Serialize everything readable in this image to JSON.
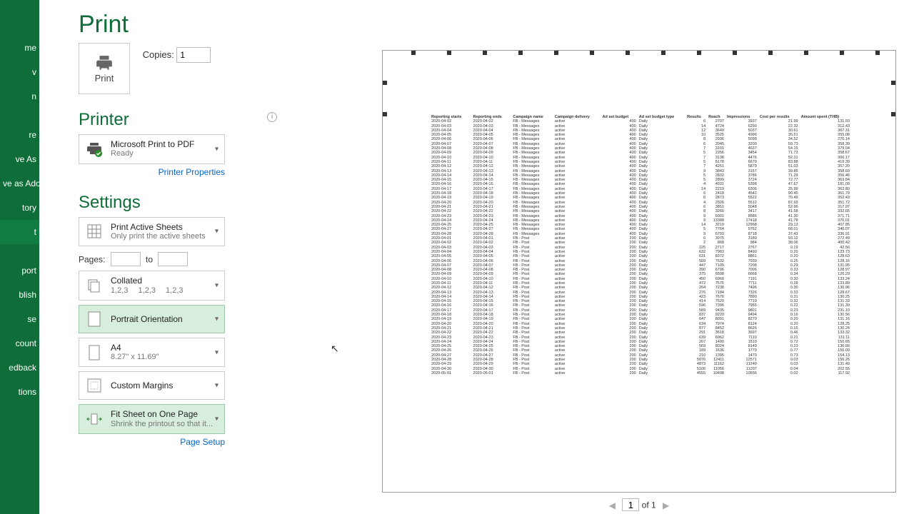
{
  "nav": [
    "me",
    "v",
    "n",
    "",
    "re",
    "ve As",
    "ve as Adobe\nF",
    "tory",
    "t",
    "",
    "port",
    "blish",
    "se",
    "count",
    "edback",
    "tions"
  ],
  "title": "Print",
  "print_label": "Print",
  "copies_label": "Copies:",
  "copies_value": "1",
  "printer_heading": "Printer",
  "printer": {
    "name": "Microsoft Print to PDF",
    "status": "Ready"
  },
  "printer_props": "Printer Properties",
  "settings_heading": "Settings",
  "what": {
    "t1": "Print Active Sheets",
    "t2": "Only print the active sheets"
  },
  "pages_label": "Pages:",
  "pages_to": "to",
  "collate": {
    "t1": "Collated",
    "t2": "1,2,3  1,2,3  1,2,3"
  },
  "orient": "Portrait Orientation",
  "paper": {
    "t1": "A4",
    "t2": "8.27\" x 11.69\""
  },
  "margins": "Custom Margins",
  "fit": {
    "t1": "Fit Sheet on One Page",
    "t2": "Shrink the printout so that it..."
  },
  "page_setup": "Page Setup",
  "page_of": "of 1",
  "page_current": "1",
  "headers": [
    "Reporting starts",
    "Reporting ends",
    "Campaign name",
    "Campaign delivery",
    "Ad set budget",
    "Ad set budget type",
    "Results",
    "Reach",
    "Impressions",
    "Cost per results",
    "Amount spent (THB)"
  ],
  "rows": [
    [
      "2020-04-02",
      "2020-04-02",
      "FB - Messages",
      "active",
      "400",
      "Daily",
      "6",
      "2707",
      "3937",
      "21.99",
      "131.93"
    ],
    [
      "2020-04-03",
      "2020-04-03",
      "FB - Messages",
      "active",
      "400",
      "Daily",
      "14",
      "4724",
      "6290",
      "22.32",
      "312.43"
    ],
    [
      "2020-04-04",
      "2020-04-04",
      "FB - Messages",
      "active",
      "400",
      "Daily",
      "12",
      "3649",
      "5037",
      "30.61",
      "367.31"
    ],
    [
      "2020-04-05",
      "2020-04-05",
      "FB - Messages",
      "active",
      "400",
      "Daily",
      "10",
      "3525",
      "4996",
      "35.51",
      "355.08"
    ],
    [
      "2020-04-06",
      "2020-04-06",
      "FB - Messages",
      "active",
      "400",
      "Daily",
      "8",
      "2936",
      "5098",
      "34.52",
      "276.14"
    ],
    [
      "2020-04-07",
      "2020-04-07",
      "FB - Messages",
      "active",
      "400",
      "Daily",
      "6",
      "2045",
      "3200",
      "59.73",
      "358.39"
    ],
    [
      "2020-04-08",
      "2020-04-08",
      "FB - Messages",
      "active",
      "400",
      "Daily",
      "7",
      "3101",
      "4637",
      "54.15",
      "379.04"
    ],
    [
      "2020-04-09",
      "2020-04-09",
      "FB - Messages",
      "active",
      "400",
      "Daily",
      "5",
      "2356",
      "3454",
      "71.73",
      "358.67"
    ],
    [
      "2020-04-10",
      "2020-04-10",
      "FB - Messages",
      "active",
      "400",
      "Daily",
      "7",
      "3138",
      "4476",
      "52.31",
      "366.17"
    ],
    [
      "2020-04-11",
      "2020-04-11",
      "FB - Messages",
      "active",
      "400",
      "Daily",
      "5",
      "5178",
      "6679",
      "83.88",
      "419.39"
    ],
    [
      "2020-04-12",
      "2020-04-12",
      "FB - Messages",
      "active",
      "400",
      "Daily",
      "7",
      "4251",
      "5879",
      "51.03",
      "357.20"
    ],
    [
      "2020-04-13",
      "2020-04-13",
      "FB - Messages",
      "active",
      "400",
      "Daily",
      "9",
      "3843",
      "3157",
      "39.85",
      "358.69"
    ],
    [
      "2020-04-14",
      "2020-04-14",
      "FB - Messages",
      "active",
      "400",
      "Daily",
      "5",
      "2832",
      "3786",
      "71.29",
      "356.46"
    ],
    [
      "2020-04-15",
      "2020-04-15",
      "FB - Messages",
      "active",
      "400",
      "Daily",
      "5",
      "2899",
      "3724",
      "72.77",
      "363.84"
    ],
    [
      "2020-04-16",
      "2020-04-16",
      "FB - Messages",
      "active",
      "400",
      "Daily",
      "4",
      "4031",
      "5398",
      "47.67",
      "181.09"
    ],
    [
      "2020-04-17",
      "2020-04-17",
      "FB - Messages",
      "active",
      "400",
      "Daily",
      "14",
      "2219",
      "6306",
      "25.99",
      "363.80"
    ],
    [
      "2020-04-18",
      "2020-04-18",
      "FB - Messages",
      "active",
      "400",
      "Daily",
      "6",
      "2418",
      "4542",
      "90.45",
      "361.79"
    ],
    [
      "2020-04-19",
      "2020-04-19",
      "FB - Messages",
      "active",
      "400",
      "Daily",
      "6",
      "2873",
      "5522",
      "70.49",
      "352.43"
    ],
    [
      "2020-04-20",
      "2020-04-20",
      "FB - Messages",
      "active",
      "400",
      "Daily",
      "4",
      "2926",
      "5512",
      "87.93",
      "351.72"
    ],
    [
      "2020-04-21",
      "2020-04-21",
      "FB - Messages",
      "active",
      "400",
      "Daily",
      "6",
      "3851",
      "5048",
      "52.96",
      "317.97"
    ],
    [
      "2020-04-22",
      "2020-04-22",
      "FB - Messages",
      "active",
      "400",
      "Daily",
      "8",
      "3266",
      "3417",
      "41.58",
      "332.65"
    ],
    [
      "2020-04-23",
      "2020-04-23",
      "FB - Messages",
      "active",
      "400",
      "Daily",
      "9",
      "6001",
      "8586",
      "41.30",
      "371.71"
    ],
    [
      "2020-04-24",
      "2020-04-24",
      "FB - Messages",
      "active",
      "400",
      "Daily",
      "9",
      "13388",
      "17418",
      "41.78",
      "376.01"
    ],
    [
      "2020-04-25",
      "2020-04-25",
      "FB - Messages",
      "active",
      "400",
      "Daily",
      "14",
      "3219",
      "12968",
      "29.13",
      "407.85"
    ],
    [
      "2020-04-27",
      "2020-04-27",
      "FB - Messages",
      "active",
      "400",
      "Daily",
      "5",
      "7764",
      "9762",
      "68.01",
      "340.07"
    ],
    [
      "2020-04-28",
      "2020-04-28",
      "FB - Messages",
      "active",
      "400",
      "Daily",
      "9",
      "6793",
      "8718",
      "37.43",
      "336.91"
    ],
    [
      "2020-04-01",
      "2020-04-01",
      "FB - Post",
      "active",
      "200",
      "Daily",
      "6",
      "3075",
      "3180",
      "93.12",
      "272.49"
    ],
    [
      "2020-04-02",
      "2020-04-02",
      "FB - Post",
      "active",
      "200",
      "Daily",
      "2",
      "868",
      "984",
      "38.06",
      "400.42"
    ],
    [
      "2020-04-03",
      "2020-04-03",
      "FB - Post",
      "active",
      "200",
      "Daily",
      "225",
      "2717",
      "2767",
      "0.19",
      "42.56"
    ],
    [
      "2020-04-04",
      "2020-04-04",
      "FB - Post",
      "active",
      "200",
      "Daily",
      "632",
      "7983",
      "8490",
      "0.20",
      "123.73"
    ],
    [
      "2020-04-05",
      "2020-04-05",
      "FB - Post",
      "active",
      "200",
      "Daily",
      "631",
      "8372",
      "8861",
      "0.20",
      "128.63"
    ],
    [
      "2020-04-06",
      "2020-04-06",
      "FB - Post",
      "active",
      "200",
      "Daily",
      "509",
      "7632",
      "7939",
      "0.25",
      "128.16"
    ],
    [
      "2020-04-07",
      "2020-04-07",
      "FB - Post",
      "active",
      "200",
      "Daily",
      "447",
      "7105",
      "7208",
      "0.29",
      "131.95"
    ],
    [
      "2020-04-08",
      "2020-04-08",
      "FB - Post",
      "active",
      "200",
      "Daily",
      "390",
      "6796",
      "7006",
      "0.33",
      "128.97"
    ],
    [
      "2020-04-09",
      "2020-04-09",
      "FB - Post",
      "active",
      "200",
      "Daily",
      "375",
      "6508",
      "6668",
      "0.34",
      "126.29"
    ],
    [
      "2020-04-10",
      "2020-04-10",
      "FB - Post",
      "active",
      "200",
      "Daily",
      "450",
      "6966",
      "7191",
      "0.30",
      "133.24"
    ],
    [
      "2020-04-11",
      "2020-04-11",
      "FB - Post",
      "active",
      "200",
      "Daily",
      "472",
      "7575",
      "7711",
      "0.28",
      "133.89"
    ],
    [
      "2020-04-12",
      "2020-04-12",
      "FB - Post",
      "active",
      "200",
      "Daily",
      "264",
      "7238",
      "7496",
      "0.30",
      "130.96"
    ],
    [
      "2020-04-13",
      "2020-04-13",
      "FB - Post",
      "active",
      "200",
      "Daily",
      "276",
      "7184",
      "7326",
      "0.33",
      "128.67"
    ],
    [
      "2020-04-14",
      "2020-04-14",
      "FB - Post",
      "active",
      "200",
      "Daily",
      "423",
      "7676",
      "7890",
      "0.31",
      "130.25"
    ],
    [
      "2020-04-15",
      "2020-04-15",
      "FB - Post",
      "active",
      "200",
      "Daily",
      "414",
      "7520",
      "7719",
      "0.32",
      "131.33"
    ],
    [
      "2020-04-16",
      "2020-04-16",
      "FB - Post",
      "active",
      "200",
      "Daily",
      "596",
      "7396",
      "7955",
      "0.22",
      "131.39"
    ],
    [
      "2020-04-17",
      "2020-04-17",
      "FB - Post",
      "active",
      "200",
      "Daily",
      "589",
      "9435",
      "9801",
      "0.23",
      "231.10"
    ],
    [
      "2020-04-18",
      "2020-04-18",
      "FB - Post",
      "active",
      "200",
      "Daily",
      "837",
      "9220",
      "9494",
      "0.16",
      "130.56"
    ],
    [
      "2020-04-19",
      "2020-04-19",
      "FB - Post",
      "active",
      "200",
      "Daily",
      "647",
      "8091",
      "8270",
      "0.20",
      "131.16"
    ],
    [
      "2020-04-20",
      "2020-04-20",
      "FB - Post",
      "active",
      "200",
      "Daily",
      "634",
      "7974",
      "8124",
      "0.20",
      "128.25"
    ],
    [
      "2020-04-21",
      "2020-04-21",
      "FB - Post",
      "active",
      "200",
      "Daily",
      "877",
      "8452",
      "8626",
      "0.15",
      "130.24"
    ],
    [
      "2020-04-22",
      "2020-04-22",
      "FB - Post",
      "active",
      "200",
      "Daily",
      "291",
      "3618",
      "3697",
      "0.46",
      "133.32"
    ],
    [
      "2020-04-23",
      "2020-04-23",
      "FB - Post",
      "active",
      "200",
      "Daily",
      "639",
      "6962",
      "7110",
      "0.21",
      "131.11"
    ],
    [
      "2020-04-24",
      "2020-04-24",
      "FB - Post",
      "active",
      "200",
      "Daily",
      "207",
      "1490",
      "1519",
      "0.72",
      "150.65"
    ],
    [
      "2020-04-25",
      "2020-04-25",
      "FB - Post",
      "active",
      "200",
      "Daily",
      "569",
      "8024",
      "8149",
      "0.23",
      "130.66"
    ],
    [
      "2020-04-26",
      "2020-04-26",
      "FB - Post",
      "active",
      "200",
      "Daily",
      "189",
      "1636",
      "1779",
      "0.77",
      "150.09"
    ],
    [
      "2020-04-27",
      "2020-04-27",
      "FB - Post",
      "active",
      "200",
      "Daily",
      "210",
      "1395",
      "1470",
      "0.73",
      "154.13"
    ],
    [
      "2020-04-28",
      "2020-04-28",
      "FB - Post",
      "active",
      "200",
      "Daily",
      "5076",
      "12411",
      "12571",
      "0.03",
      "150.26"
    ],
    [
      "2020-04-29",
      "2020-04-29",
      "FB - Post",
      "active",
      "200",
      "Daily",
      "4873",
      "11162",
      "11249",
      "0.03",
      "131.49"
    ],
    [
      "2020-04-30",
      "2020-04-30",
      "FB - Post",
      "active",
      "200",
      "Daily",
      "5106",
      "11056",
      "11207",
      "0.04",
      "202.55"
    ],
    [
      "2020-05-01",
      "2020-05-01",
      "FB - Post",
      "active",
      "200",
      "Daily",
      "4555",
      "10498",
      "10556",
      "0.02",
      "117.92"
    ]
  ]
}
